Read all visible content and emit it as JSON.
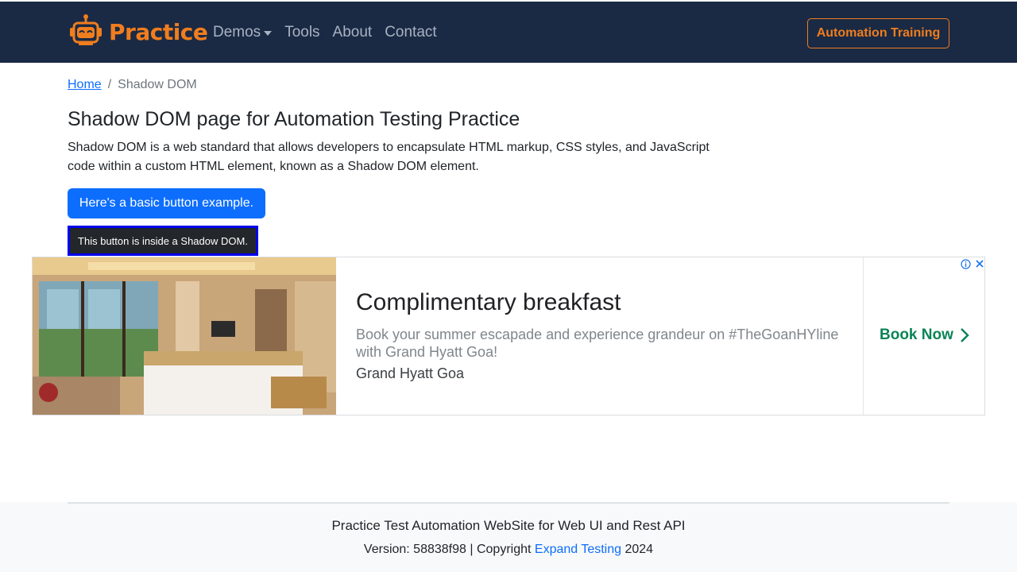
{
  "navbar": {
    "brand": "Practice",
    "logo_icon": "robot-logo-icon",
    "links": [
      {
        "label": "Demos",
        "has_dropdown": true
      },
      {
        "label": "Tools"
      },
      {
        "label": "About"
      },
      {
        "label": "Contact"
      }
    ],
    "cta": "Automation Training"
  },
  "breadcrumb": {
    "home": "Home",
    "separator": "/",
    "current": "Shadow DOM"
  },
  "main": {
    "title": "Shadow DOM page for Automation Testing Practice",
    "intro": "Shadow DOM is a web standard that allows developers to encapsulate HTML markup, CSS styles, and JavaScript code within a custom HTML element, known as a Shadow DOM element.",
    "basic_button": "Here's a basic button example.",
    "shadow_button": "This button is inside a Shadow DOM."
  },
  "ad": {
    "headline": "Complimentary breakfast",
    "description": "Book your summer escapade and experience grandeur on #TheGoanHYline with Grand Hyatt Goa!",
    "advertiser": "Grand Hyatt Goa",
    "cta": "Book Now",
    "icons": [
      "ad-info-icon",
      "ad-close-icon",
      "chevron-right-icon"
    ]
  },
  "footer": {
    "title": "Practice Test Automation WebSite for Web UI and Rest API",
    "version_prefix": "Version: 58838f98 | Copyright ",
    "link": "Expand Testing",
    "year": " 2024"
  },
  "colors": {
    "navbar_bg": "#1a2a44",
    "brand_orange": "#f07d1e",
    "primary_blue": "#0d6efd",
    "ad_cta_green": "#0b8457",
    "shadow_button_border": "#0000ee"
  }
}
